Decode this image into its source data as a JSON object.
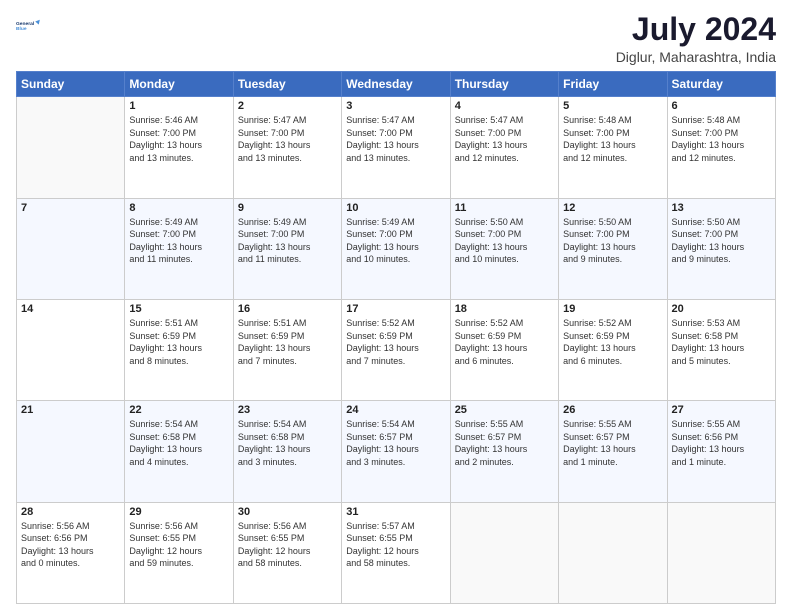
{
  "header": {
    "logo_line1": "General",
    "logo_line2": "Blue",
    "main_title": "July 2024",
    "subtitle": "Diglur, Maharashtra, India"
  },
  "days_of_week": [
    "Sunday",
    "Monday",
    "Tuesday",
    "Wednesday",
    "Thursday",
    "Friday",
    "Saturday"
  ],
  "weeks": [
    [
      {
        "day": "",
        "info": ""
      },
      {
        "day": "1",
        "info": "Sunrise: 5:46 AM\nSunset: 7:00 PM\nDaylight: 13 hours\nand 13 minutes."
      },
      {
        "day": "2",
        "info": "Sunrise: 5:47 AM\nSunset: 7:00 PM\nDaylight: 13 hours\nand 13 minutes."
      },
      {
        "day": "3",
        "info": "Sunrise: 5:47 AM\nSunset: 7:00 PM\nDaylight: 13 hours\nand 13 minutes."
      },
      {
        "day": "4",
        "info": "Sunrise: 5:47 AM\nSunset: 7:00 PM\nDaylight: 13 hours\nand 12 minutes."
      },
      {
        "day": "5",
        "info": "Sunrise: 5:48 AM\nSunset: 7:00 PM\nDaylight: 13 hours\nand 12 minutes."
      },
      {
        "day": "6",
        "info": "Sunrise: 5:48 AM\nSunset: 7:00 PM\nDaylight: 13 hours\nand 12 minutes."
      }
    ],
    [
      {
        "day": "7",
        "info": ""
      },
      {
        "day": "8",
        "info": "Sunrise: 5:49 AM\nSunset: 7:00 PM\nDaylight: 13 hours\nand 11 minutes."
      },
      {
        "day": "9",
        "info": "Sunrise: 5:49 AM\nSunset: 7:00 PM\nDaylight: 13 hours\nand 11 minutes."
      },
      {
        "day": "10",
        "info": "Sunrise: 5:49 AM\nSunset: 7:00 PM\nDaylight: 13 hours\nand 10 minutes."
      },
      {
        "day": "11",
        "info": "Sunrise: 5:50 AM\nSunset: 7:00 PM\nDaylight: 13 hours\nand 10 minutes."
      },
      {
        "day": "12",
        "info": "Sunrise: 5:50 AM\nSunset: 7:00 PM\nDaylight: 13 hours\nand 9 minutes."
      },
      {
        "day": "13",
        "info": "Sunrise: 5:50 AM\nSunset: 7:00 PM\nDaylight: 13 hours\nand 9 minutes."
      }
    ],
    [
      {
        "day": "14",
        "info": ""
      },
      {
        "day": "15",
        "info": "Sunrise: 5:51 AM\nSunset: 6:59 PM\nDaylight: 13 hours\nand 8 minutes."
      },
      {
        "day": "16",
        "info": "Sunrise: 5:51 AM\nSunset: 6:59 PM\nDaylight: 13 hours\nand 7 minutes."
      },
      {
        "day": "17",
        "info": "Sunrise: 5:52 AM\nSunset: 6:59 PM\nDaylight: 13 hours\nand 7 minutes."
      },
      {
        "day": "18",
        "info": "Sunrise: 5:52 AM\nSunset: 6:59 PM\nDaylight: 13 hours\nand 6 minutes."
      },
      {
        "day": "19",
        "info": "Sunrise: 5:52 AM\nSunset: 6:59 PM\nDaylight: 13 hours\nand 6 minutes."
      },
      {
        "day": "20",
        "info": "Sunrise: 5:53 AM\nSunset: 6:58 PM\nDaylight: 13 hours\nand 5 minutes."
      }
    ],
    [
      {
        "day": "21",
        "info": ""
      },
      {
        "day": "22",
        "info": "Sunrise: 5:54 AM\nSunset: 6:58 PM\nDaylight: 13 hours\nand 4 minutes."
      },
      {
        "day": "23",
        "info": "Sunrise: 5:54 AM\nSunset: 6:58 PM\nDaylight: 13 hours\nand 3 minutes."
      },
      {
        "day": "24",
        "info": "Sunrise: 5:54 AM\nSunset: 6:57 PM\nDaylight: 13 hours\nand 3 minutes."
      },
      {
        "day": "25",
        "info": "Sunrise: 5:55 AM\nSunset: 6:57 PM\nDaylight: 13 hours\nand 2 minutes."
      },
      {
        "day": "26",
        "info": "Sunrise: 5:55 AM\nSunset: 6:57 PM\nDaylight: 13 hours\nand 1 minute."
      },
      {
        "day": "27",
        "info": "Sunrise: 5:55 AM\nSunset: 6:56 PM\nDaylight: 13 hours\nand 1 minute."
      }
    ],
    [
      {
        "day": "28",
        "info": "Sunrise: 5:56 AM\nSunset: 6:56 PM\nDaylight: 13 hours\nand 0 minutes."
      },
      {
        "day": "29",
        "info": "Sunrise: 5:56 AM\nSunset: 6:55 PM\nDaylight: 12 hours\nand 59 minutes."
      },
      {
        "day": "30",
        "info": "Sunrise: 5:56 AM\nSunset: 6:55 PM\nDaylight: 12 hours\nand 58 minutes."
      },
      {
        "day": "31",
        "info": "Sunrise: 5:57 AM\nSunset: 6:55 PM\nDaylight: 12 hours\nand 58 minutes."
      },
      {
        "day": "",
        "info": ""
      },
      {
        "day": "",
        "info": ""
      },
      {
        "day": "",
        "info": ""
      }
    ]
  ]
}
